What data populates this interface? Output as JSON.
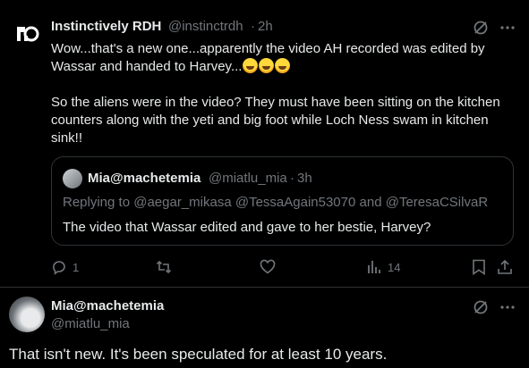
{
  "tweet": {
    "author_name": "Instinctively RDH",
    "author_handle": "@instinctrdh",
    "sep": "·",
    "time": "2h",
    "line1": "Wow...that's a new one...apparently the video AH recorded was edited by",
    "line2": "Wassar and handed to Harvey...",
    "line3": "So the aliens were in the video? They must have been sitting on the kitchen",
    "line4": "counters along with the yeti and big foot while Loch Ness swam in kitchen",
    "line5": "sink!!",
    "emojis": [
      "rolling-on-floor-laughing",
      "rolling-on-floor-laughing",
      "rolling-on-floor-laughing"
    ]
  },
  "quote": {
    "author_name": "Mia@machetemia",
    "author_handle": "@miatlu_mia",
    "sep": "·",
    "time": "3h",
    "replying_prefix": "Replying to",
    "replying_to_1": "@aegar_mikasa",
    "replying_to_2": "@TessaAgain53070",
    "replying_and": "and",
    "replying_to_3": "@TeresaCSilvaR",
    "text": "The video that Wassar edited and gave to her bestie, Harvey?"
  },
  "actions": {
    "reply_count": "1",
    "retweet_count": "",
    "like_count": "",
    "views_count": "14"
  },
  "reply": {
    "author_name": "Mia@machetemia",
    "author_handle": "@miatlu_mia",
    "text": "That isn't new. It's been speculated for at least 10 years."
  },
  "colors": {
    "background": "#000000",
    "text": "#e7e9ea",
    "muted": "#71767b",
    "border": "#2f3336"
  }
}
